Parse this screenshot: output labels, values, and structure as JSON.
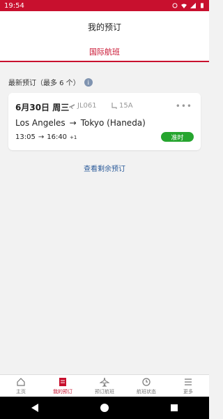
{
  "statusbar": {
    "time": "19:54"
  },
  "header": {
    "title": "我的预订",
    "tab": "国际航班"
  },
  "bookings": {
    "section_label": "最新预订（最多 6 个）"
  },
  "card": {
    "date": "6月30日 周三",
    "flight": "JL061",
    "seat": "15A",
    "origin": "Los Angeles",
    "arrow": "→",
    "destination": "Tokyo (Haneda)",
    "depart_time": "13:05",
    "arrive_time": "16:40",
    "day_offset": "+1",
    "status": "准时"
  },
  "view_more": "查看剩余预订",
  "bottom_nav": [
    {
      "label": "主页"
    },
    {
      "label": "我的预订"
    },
    {
      "label": "预订航班"
    },
    {
      "label": "航班状态"
    },
    {
      "label": "更多"
    }
  ],
  "colors": {
    "brand": "#c8102e",
    "status_ok": "#26a52f",
    "link": "#2b5b9a"
  }
}
